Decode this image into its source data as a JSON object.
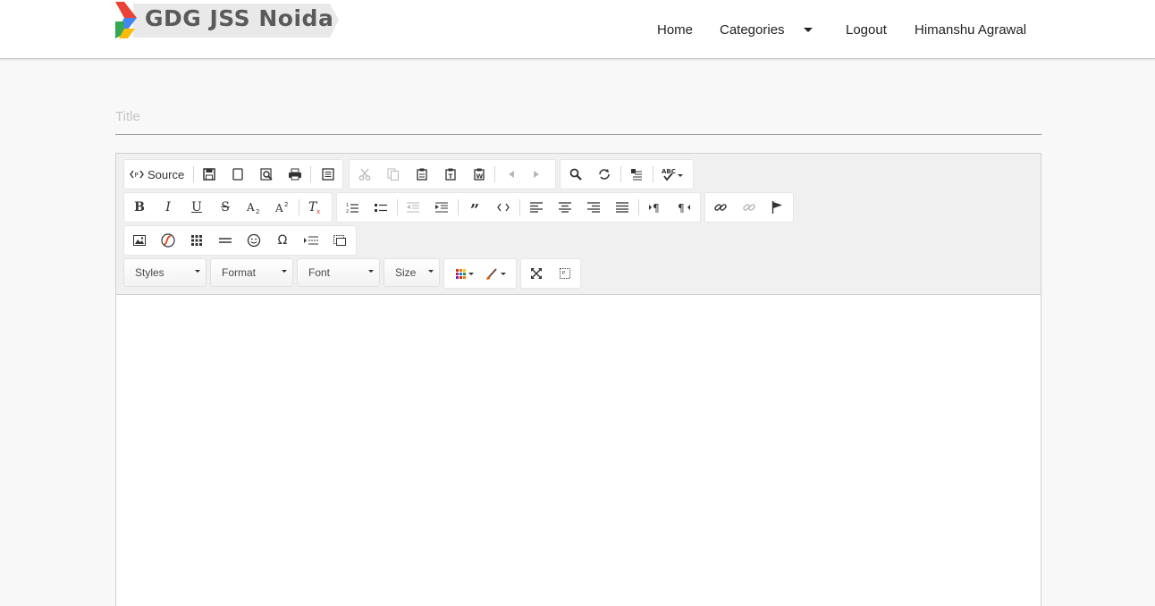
{
  "brand": {
    "text": "GDG JSS Noida",
    "colors": [
      "#ea4335",
      "#4285f4",
      "#34a853",
      "#fbbc05"
    ]
  },
  "nav": {
    "home": "Home",
    "categories": "Categories",
    "logout": "Logout",
    "user": "Himanshu Agrawal"
  },
  "form": {
    "title_placeholder": "Title",
    "title_value": ""
  },
  "toolbar": {
    "source_label": "Source",
    "styles": "Styles",
    "format": "Format",
    "font": "Font",
    "size": "Size"
  },
  "icons": [
    "source-icon",
    "save-icon",
    "new-page-icon",
    "preview-icon",
    "print-icon",
    "templates-icon",
    "cut-icon",
    "copy-icon",
    "paste-icon",
    "paste-text-icon",
    "paste-word-icon",
    "undo-icon",
    "redo-icon",
    "find-icon",
    "replace-icon",
    "select-all-icon",
    "spellcheck-icon",
    "bold-icon",
    "italic-icon",
    "underline-icon",
    "strike-icon",
    "subscript-icon",
    "superscript-icon",
    "remove-format-icon",
    "numbered-list-icon",
    "bulleted-list-icon",
    "outdent-icon",
    "indent-icon",
    "blockquote-icon",
    "code-icon",
    "align-left-icon",
    "align-center-icon",
    "align-right-icon",
    "justify-icon",
    "ltr-icon",
    "rtl-icon",
    "link-icon",
    "unlink-icon",
    "anchor-icon",
    "image-icon",
    "flash-icon",
    "table-icon",
    "horizontal-line-icon",
    "smiley-icon",
    "special-char-icon",
    "page-break-icon",
    "iframe-icon",
    "text-color-icon",
    "bg-color-icon",
    "maximize-icon",
    "show-blocks-icon"
  ]
}
